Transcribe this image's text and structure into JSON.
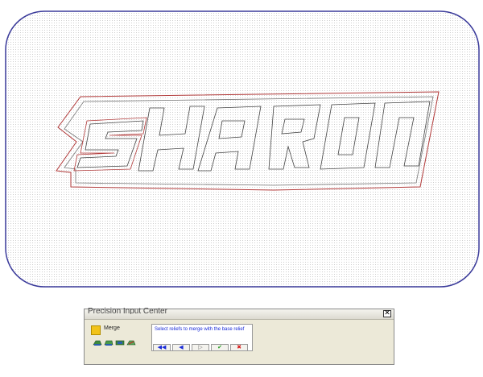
{
  "canvas": {
    "relief_text": "SHARON",
    "colors": {
      "background": "#ffffff",
      "dot_grid": "#cfcfcf",
      "border": "#3a3a9a",
      "outer_outline": "#b23a3a",
      "inner_outline": "#555555"
    }
  },
  "dialog": {
    "title": "Precision Input Center",
    "close_glyph": "✕",
    "merge_label": "Merge",
    "merge_color": "#f2c31a",
    "prompt": "Select reliefs to merge with the base relief",
    "relief_icons": [
      "relief-icon-1",
      "relief-icon-2",
      "relief-icon-3",
      "relief-icon-4"
    ],
    "nav": {
      "first": "◀◀",
      "prev": "◀",
      "next": "▷",
      "ok": "✔",
      "cancel": "✖"
    },
    "nav_colors": {
      "arrows": "#1a2bd8",
      "ok": "#1e9a1e",
      "cancel": "#d81a1a"
    }
  }
}
